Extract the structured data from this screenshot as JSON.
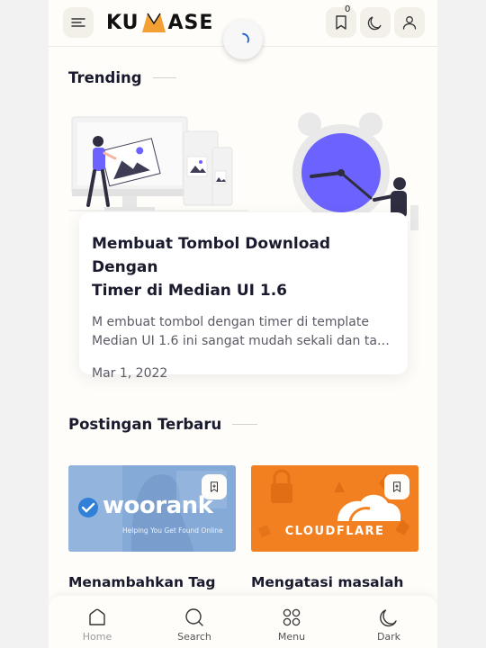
{
  "header": {
    "logo_left": "KU",
    "logo_right": "ASE",
    "bookmark_count": "0"
  },
  "trending": {
    "section_title": "Trending",
    "card": {
      "title_line1": "Membuat Tombol Download Dengan",
      "title_line2": "Timer di Median UI 1.6",
      "excerpt_line1": "M embuat tombol dengan timer di template",
      "excerpt_line2": "Median UI 1.6 ini sangat mudah sekali dan tanp...",
      "date": "Mar 1, 2022"
    }
  },
  "latest": {
    "section_title": "Postingan Terbaru",
    "posts": [
      {
        "thumb_brand": "woorank",
        "thumb_tagline": "Helping You Get Found Online",
        "title": "Menambahkan Tag"
      },
      {
        "thumb_brand": "CLOUDFLARE",
        "title": "Mengatasi masalah"
      }
    ]
  },
  "bottom_nav": {
    "items": [
      {
        "label": "Home",
        "icon": "home-icon"
      },
      {
        "label": "Search",
        "icon": "search-icon"
      },
      {
        "label": "Menu",
        "icon": "grid-icon"
      },
      {
        "label": "Dark",
        "icon": "moon-icon"
      }
    ]
  },
  "colors": {
    "background": "#fffdf9",
    "accent_purple": "#6c63ff",
    "cloudflare_orange": "#f38020",
    "woorank_blue": "#7ea6d4",
    "logo_orange": "#f2a033"
  }
}
